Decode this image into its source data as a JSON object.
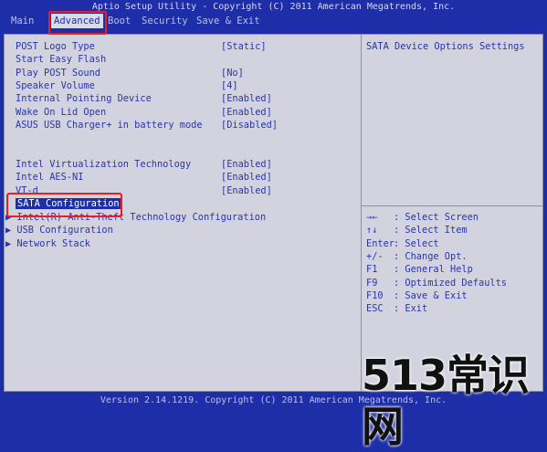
{
  "title": "Aptio Setup Utility - Copyright (C) 2011 American Megatrends, Inc.",
  "menu": {
    "main": "Main",
    "advanced": "Advanced",
    "boot": "Boot",
    "security": "Security",
    "save_exit": "Save & Exit"
  },
  "settings": [
    {
      "label": "POST Logo Type",
      "value": "[Static]"
    },
    {
      "label": "Start Easy Flash",
      "value": ""
    },
    {
      "label": "Play POST Sound",
      "value": "[No]"
    },
    {
      "label": "Speaker Volume",
      "value": "[4]"
    },
    {
      "label": "Internal Pointing Device",
      "value": "[Enabled]"
    },
    {
      "label": "Wake On Lid Open",
      "value": "[Enabled]"
    },
    {
      "label": "ASUS USB Charger+ in battery mode",
      "value": "[Disabled]"
    },
    {
      "label": "Intel Virtualization Technology",
      "value": "[Enabled]"
    },
    {
      "label": "Intel AES-NI",
      "value": "[Enabled]"
    },
    {
      "label": "VT-d",
      "value": "[Enabled]"
    }
  ],
  "submenus": [
    {
      "label": "SATA Configuration",
      "arrow": ""
    },
    {
      "label": "Intel(R) Anti-Theft Technology Configuration",
      "arrow": "▶"
    },
    {
      "label": "USB Configuration",
      "arrow": "▶"
    },
    {
      "label": "Network Stack",
      "arrow": "▶"
    }
  ],
  "help": {
    "description": "SATA Device Options Settings",
    "keys": [
      {
        "key": "→←",
        "desc": ": Select Screen"
      },
      {
        "key": "↑↓",
        "desc": ": Select Item"
      },
      {
        "key": "Enter",
        "desc": ": Select"
      },
      {
        "key": "+/-",
        "desc": ": Change Opt."
      },
      {
        "key": "F1",
        "desc": ": General Help"
      },
      {
        "key": "F9",
        "desc": ": Optimized Defaults"
      },
      {
        "key": "F10",
        "desc": ": Save & Exit"
      },
      {
        "key": "ESC",
        "desc": ": Exit"
      }
    ]
  },
  "footer": "Version 2.14.1219. Copyright (C) 2011 American Megatrends, Inc.",
  "watermark": "513常识网",
  "colors": {
    "background": "#1e2ea8",
    "panel": "#d2d3de",
    "text": "#2a36a8",
    "highlight": "#ee1c25"
  }
}
